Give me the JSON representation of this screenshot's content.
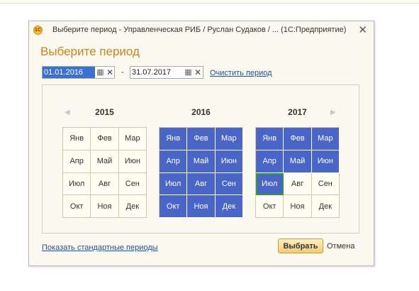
{
  "window": {
    "title": "Выберите период - Управленческая РИБ / Руслан Судаков / ...  (1С:Предприятие)",
    "app_icon_text": "1С",
    "close_glyph": "✕"
  },
  "dialog": {
    "heading": "Выберите период"
  },
  "period": {
    "start": "01.01.2016",
    "dash": "-",
    "end": "31.07.2017",
    "clear_link": "Очистить период",
    "calendar_icon": "calendar-icon",
    "clear_icon": "clear-icon"
  },
  "calendar": {
    "prev_arrow": "◀",
    "next_arrow": "▶",
    "years": [
      {
        "year": "2015",
        "months": [
          {
            "label": "Янв",
            "selected": false
          },
          {
            "label": "Фев",
            "selected": false
          },
          {
            "label": "Мар",
            "selected": false
          },
          {
            "label": "Апр",
            "selected": false
          },
          {
            "label": "Май",
            "selected": false
          },
          {
            "label": "Июн",
            "selected": false
          },
          {
            "label": "Июл",
            "selected": false
          },
          {
            "label": "Авг",
            "selected": false
          },
          {
            "label": "Сен",
            "selected": false
          },
          {
            "label": "Окт",
            "selected": false
          },
          {
            "label": "Ноя",
            "selected": false
          },
          {
            "label": "Дек",
            "selected": false
          }
        ]
      },
      {
        "year": "2016",
        "months": [
          {
            "label": "Янв",
            "selected": true
          },
          {
            "label": "Фев",
            "selected": true
          },
          {
            "label": "Мар",
            "selected": true
          },
          {
            "label": "Апр",
            "selected": true
          },
          {
            "label": "Май",
            "selected": true
          },
          {
            "label": "Июн",
            "selected": true
          },
          {
            "label": "Июл",
            "selected": true
          },
          {
            "label": "Авг",
            "selected": true
          },
          {
            "label": "Сен",
            "selected": true
          },
          {
            "label": "Окт",
            "selected": true
          },
          {
            "label": "Ноя",
            "selected": true
          },
          {
            "label": "Дек",
            "selected": true
          }
        ]
      },
      {
        "year": "2017",
        "months": [
          {
            "label": "Янв",
            "selected": true
          },
          {
            "label": "Фев",
            "selected": true
          },
          {
            "label": "Мар",
            "selected": true
          },
          {
            "label": "Апр",
            "selected": true
          },
          {
            "label": "Май",
            "selected": true
          },
          {
            "label": "Июн",
            "selected": true
          },
          {
            "label": "Июл",
            "selected": true,
            "current": true
          },
          {
            "label": "Авг",
            "selected": false
          },
          {
            "label": "Сен",
            "selected": false
          },
          {
            "label": "Окт",
            "selected": false
          },
          {
            "label": "Ноя",
            "selected": false
          },
          {
            "label": "Дек",
            "selected": false
          }
        ]
      }
    ]
  },
  "footer": {
    "standard_periods_link": "Показать стандартные периоды",
    "choose_button": "Выбрать",
    "cancel_button": "Отмена"
  },
  "colors": {
    "accent_heading": "#c8861e",
    "selected_month": "#4a65c8",
    "current_month_border": "#2d9a3c",
    "link": "#1f4e9b",
    "dialog_background": "#fbf9ef"
  }
}
